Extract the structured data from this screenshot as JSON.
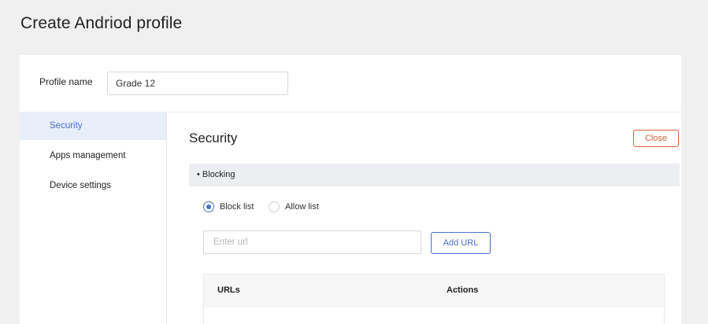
{
  "page": {
    "title": "Create Andriod profile"
  },
  "profile": {
    "label": "Profile name",
    "value": "Grade 12"
  },
  "sidebar": {
    "items": [
      {
        "label": "Security",
        "active": true
      },
      {
        "label": "Apps management",
        "active": false
      },
      {
        "label": "Device settings",
        "active": false
      }
    ]
  },
  "section": {
    "title": "Security",
    "close_label": "Close",
    "blocking_label": "• Blocking",
    "radios": [
      {
        "label": "Block list",
        "checked": true
      },
      {
        "label": "Allow list",
        "checked": false
      }
    ],
    "url_input": {
      "placeholder": "Enter url",
      "value": ""
    },
    "add_url_label": "Add URL",
    "table": {
      "columns": [
        "URLs",
        "Actions"
      ],
      "rows": []
    }
  },
  "colors": {
    "accent": "#4a6fd1",
    "danger": "#e0603e",
    "active_bg": "#e8eef7",
    "page_bg": "#f0f0f0"
  }
}
